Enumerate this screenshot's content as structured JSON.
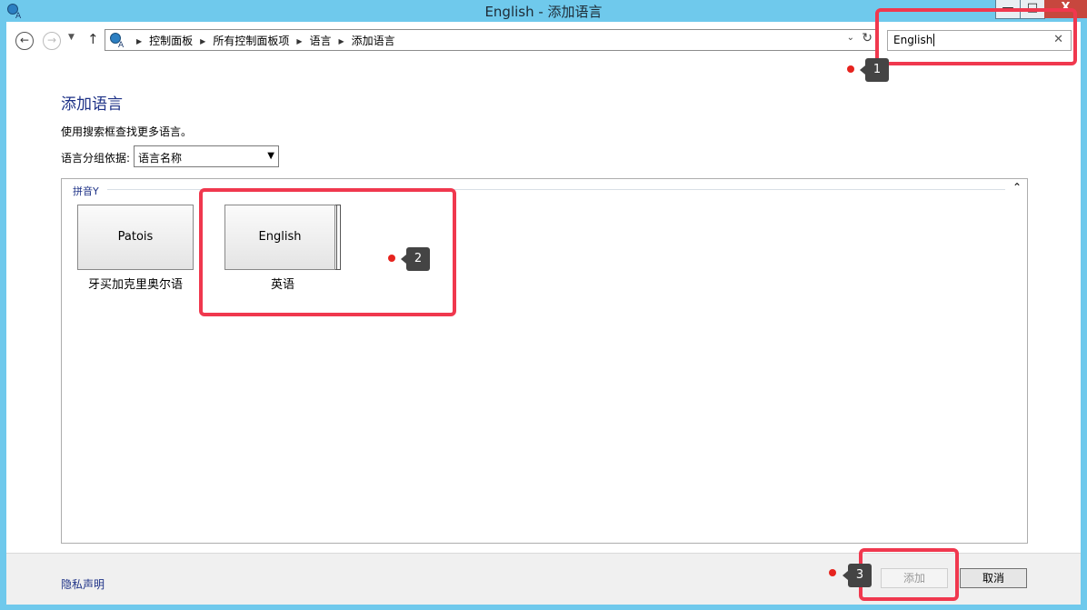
{
  "window": {
    "title": "English - 添加语言",
    "minimize_label": "—",
    "maximize_label": "□",
    "close_label": "X"
  },
  "nav": {
    "breadcrumbs": [
      "控制面板",
      "所有控制面板项",
      "语言",
      "添加语言"
    ],
    "search_value": "English",
    "search_clear": "✕"
  },
  "main": {
    "title": "添加语言",
    "hint": "使用搜索框查找更多语言。",
    "group_by_label": "语言分组依据:",
    "group_by_value": "语言名称",
    "section_label": "拼音Y",
    "tiles": [
      {
        "name": "Patois",
        "caption": "牙买加克里奥尔语"
      },
      {
        "name": "English",
        "caption": "英语"
      }
    ]
  },
  "footer": {
    "privacy_link": "隐私声明",
    "add_label": "添加",
    "cancel_label": "取消"
  },
  "annotations": {
    "badges": [
      "1",
      "2",
      "3"
    ],
    "color": "#f0384e"
  }
}
